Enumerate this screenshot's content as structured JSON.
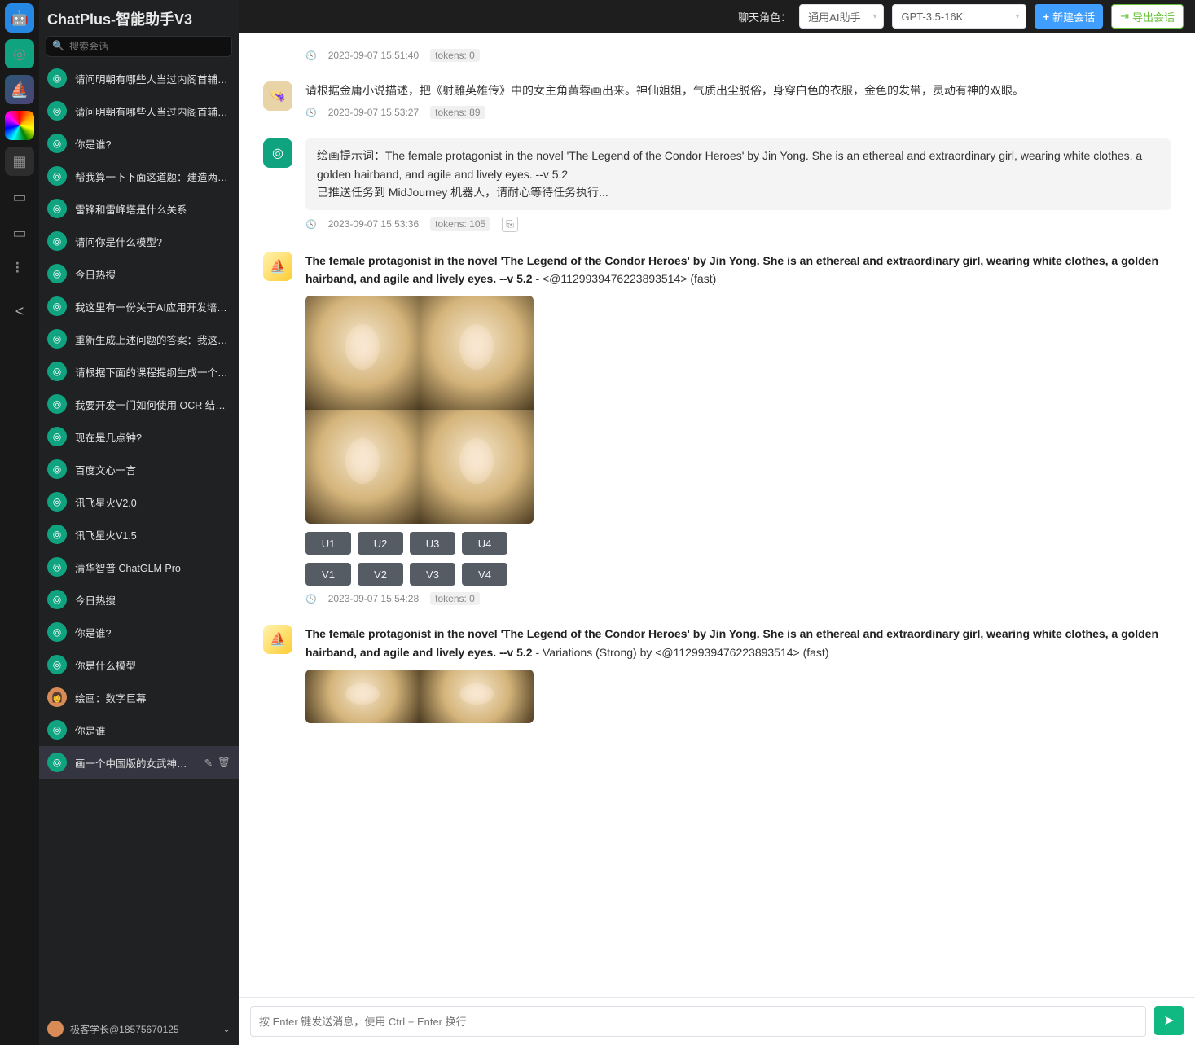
{
  "app_title": "ChatPlus-智能助手V3",
  "search_placeholder": "搜索会话",
  "conversations": [
    {
      "title": "请问明朝有哪些人当过内阁首辅…",
      "icon": "ai"
    },
    {
      "title": "请问明朝有哪些人当过内阁首辅…",
      "icon": "ai"
    },
    {
      "title": "你是谁?",
      "icon": "ai"
    },
    {
      "title": "帮我算一下下面这道题：建造两…",
      "icon": "ai"
    },
    {
      "title": "雷锋和雷峰塔是什么关系",
      "icon": "ai"
    },
    {
      "title": "请问你是什么模型?",
      "icon": "ai"
    },
    {
      "title": "今日热搜",
      "icon": "ai"
    },
    {
      "title": "我这里有一份关于AI应用开发培…",
      "icon": "ai"
    },
    {
      "title": "重新生成上述问题的答案：我这…",
      "icon": "ai"
    },
    {
      "title": "请根据下面的课程提纲生成一个…",
      "icon": "ai"
    },
    {
      "title": "我要开发一门如何使用 OCR 结…",
      "icon": "ai"
    },
    {
      "title": "现在是几点钟?",
      "icon": "ai"
    },
    {
      "title": "百度文心一言",
      "icon": "ai"
    },
    {
      "title": "讯飞星火V2.0",
      "icon": "ai"
    },
    {
      "title": "讯飞星火V1.5",
      "icon": "ai"
    },
    {
      "title": "清华智普 ChatGLM Pro",
      "icon": "ai"
    },
    {
      "title": "今日热搜",
      "icon": "ai"
    },
    {
      "title": "你是谁?",
      "icon": "ai"
    },
    {
      "title": "你是什么模型",
      "icon": "ai"
    },
    {
      "title": "绘画：数字巨幕",
      "icon": "user"
    },
    {
      "title": "你是谁",
      "icon": "ai"
    },
    {
      "title": "画一个中国版的女武神，身穿红…",
      "icon": "ai",
      "active": true
    }
  ],
  "footer_user": "极客学长@18575670125",
  "topbar": {
    "role_label": "聊天角色：",
    "role_value": "通用AI助手",
    "model_value": "GPT-3.5-16K",
    "new_chat": "新建会话",
    "export": "导出会话"
  },
  "messages": {
    "m0_time": "2023-09-07 15:51:40",
    "m0_tokens": "tokens: 0",
    "m1_text": "请根据金庸小说描述，把《射雕英雄传》中的女主角黄蓉画出来。神仙姐姐，气质出尘脱俗，身穿白色的衣服，金色的发带，灵动有神的双眼。",
    "m1_time": "2023-09-07 15:53:27",
    "m1_tokens": "tokens: 89",
    "m2_text": "绘画提示词：The female protagonist in the novel 'The Legend of the Condor Heroes' by Jin Yong. She is an ethereal and extraordinary girl, wearing white clothes, a golden hairband, and agile and lively eyes. --v 5.2\n已推送任务到 MidJourney 机器人，请耐心等待任务执行...",
    "m2_time": "2023-09-07 15:53:36",
    "m2_tokens": "tokens: 105",
    "m3_bold": "The female protagonist in the novel 'The Legend of the Condor Heroes' by Jin Yong. She is an ethereal and extraordinary girl, wearing white clothes, a golden hairband, and agile and lively eyes. --v 5.2",
    "m3_rest": " - <@1129939476223893514> (fast)",
    "m3_time": "2023-09-07 15:54:28",
    "m3_tokens": "tokens: 0",
    "m4_bold": "The female protagonist in the novel 'The Legend of the Condor Heroes' by Jin Yong. She is an ethereal and extraordinary girl, wearing white clothes, a golden hairband, and agile and lively eyes. --v 5.2",
    "m4_rest": " - Variations (Strong) by <@1129939476223893514> (fast)"
  },
  "uv": {
    "u1": "U1",
    "u2": "U2",
    "u3": "U3",
    "u4": "U4",
    "v1": "V1",
    "v2": "V2",
    "v3": "V3",
    "v4": "V4"
  },
  "composer_placeholder": "按 Enter 键发送消息，使用 Ctrl + Enter 换行",
  "rail_icons": [
    "robot",
    "openai",
    "midjourney",
    "rainbow",
    "grid",
    "doc",
    "book",
    "people",
    "share"
  ]
}
